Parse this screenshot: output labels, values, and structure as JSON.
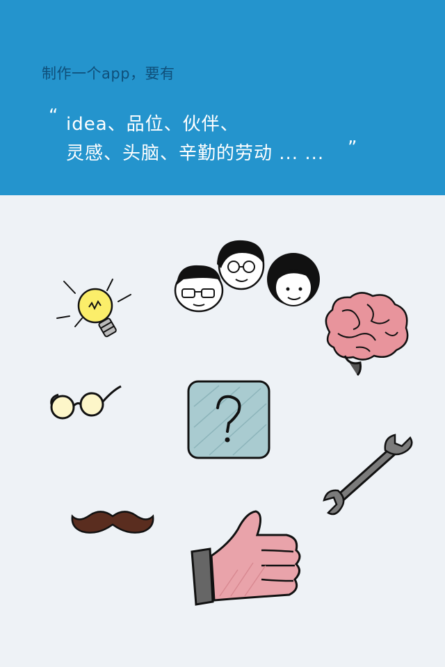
{
  "header": {
    "subtitle": "制作一个app，要有",
    "quote_open": "“",
    "line1": "idea、品位、伙伴、",
    "line2": "灵感、头脑、辛勤的劳动 ... ...",
    "quote_close": "”"
  },
  "illustrations": [
    {
      "name": "lightbulb-icon",
      "meaning": "idea"
    },
    {
      "name": "people-icon",
      "meaning": "伙伴"
    },
    {
      "name": "brain-icon",
      "meaning": "头脑"
    },
    {
      "name": "glasses-icon",
      "meaning": "品位"
    },
    {
      "name": "question-box-icon",
      "meaning": "?"
    },
    {
      "name": "wrench-icon",
      "meaning": "辛勤的劳动"
    },
    {
      "name": "mustache-icon",
      "meaning": "品位"
    },
    {
      "name": "thumbs-up-icon",
      "meaning": "灵感"
    }
  ],
  "colors": {
    "header_bg": "#2494cd",
    "body_bg": "#eef2f6",
    "subtitle": "#0f4f7a",
    "quote_text": "#ffffff"
  }
}
